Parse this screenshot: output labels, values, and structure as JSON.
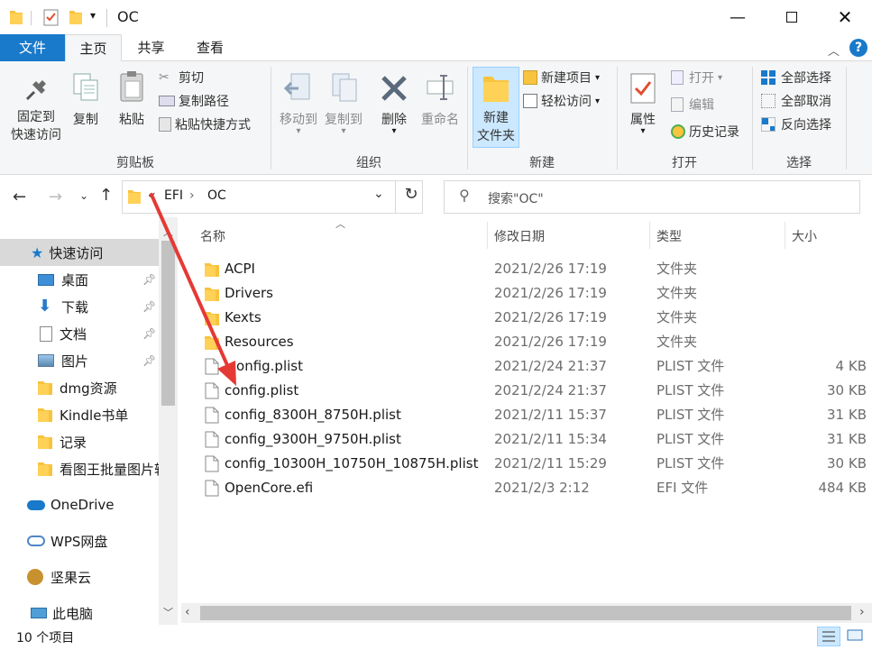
{
  "window": {
    "title": "OC"
  },
  "ribbon": {
    "tabs": [
      "文件",
      "主页",
      "共享",
      "查看"
    ],
    "clipboard": {
      "group": "剪贴板",
      "pin_label": "固定到\n快速访问",
      "copy": "复制",
      "paste": "粘贴",
      "cut": "剪切",
      "copy_path": "复制路径",
      "paste_shortcut": "粘贴快捷方式"
    },
    "organize": {
      "group": "组织",
      "move_to": "移动到",
      "copy_to": "复制到",
      "delete": "删除",
      "rename": "重命名"
    },
    "new": {
      "group": "新建",
      "new_folder": "新建\n文件夹",
      "new_item": "新建项目",
      "easy_access": "轻松访问"
    },
    "open": {
      "group": "打开",
      "properties": "属性",
      "open": "打开",
      "edit": "编辑",
      "history": "历史记录"
    },
    "select": {
      "group": "选择",
      "select_all": "全部选择",
      "select_none": "全部取消",
      "invert": "反向选择"
    }
  },
  "address": {
    "prefix": "«",
    "crumbs": [
      "EFI",
      "OC"
    ],
    "sep": "›"
  },
  "search": {
    "placeholder": "搜索\"OC\""
  },
  "nav": {
    "quick_access": "快速访问",
    "items": [
      {
        "label": "桌面",
        "icon": "desktop-icon",
        "pinned": true
      },
      {
        "label": "下载",
        "icon": "download-icon",
        "pinned": true
      },
      {
        "label": "文档",
        "icon": "document-icon",
        "pinned": true
      },
      {
        "label": "图片",
        "icon": "picture-icon",
        "pinned": true
      },
      {
        "label": "dmg资源",
        "icon": "folder-icon",
        "pinned": false
      },
      {
        "label": "Kindle书单",
        "icon": "folder-icon",
        "pinned": false
      },
      {
        "label": "记录",
        "icon": "folder-icon",
        "pinned": false
      },
      {
        "label": "看图王批量图片转",
        "icon": "folder-icon",
        "pinned": false
      }
    ],
    "onedrive": "OneDrive",
    "wps": "WPS网盘",
    "jianguo": "坚果云",
    "thispc": "此电脑"
  },
  "list": {
    "columns": {
      "name": "名称",
      "date": "修改日期",
      "type": "类型",
      "size": "大小"
    },
    "rows": [
      {
        "name": "ACPI",
        "date": "2021/2/26 17:19",
        "type": "文件夹",
        "size": "",
        "kind": "folder"
      },
      {
        "name": "Drivers",
        "date": "2021/2/26 17:19",
        "type": "文件夹",
        "size": "",
        "kind": "folder"
      },
      {
        "name": "Kexts",
        "date": "2021/2/26 17:19",
        "type": "文件夹",
        "size": "",
        "kind": "folder"
      },
      {
        "name": "Resources",
        "date": "2021/2/26 17:19",
        "type": "文件夹",
        "size": "",
        "kind": "folder"
      },
      {
        "name": ".config.plist",
        "date": "2021/2/24 21:37",
        "type": "PLIST 文件",
        "size": "4 KB",
        "kind": "file"
      },
      {
        "name": "config.plist",
        "date": "2021/2/24 21:37",
        "type": "PLIST 文件",
        "size": "30 KB",
        "kind": "file"
      },
      {
        "name": "config_8300H_8750H.plist",
        "date": "2021/2/11 15:37",
        "type": "PLIST 文件",
        "size": "31 KB",
        "kind": "file"
      },
      {
        "name": "config_9300H_9750H.plist",
        "date": "2021/2/11 15:34",
        "type": "PLIST 文件",
        "size": "31 KB",
        "kind": "file"
      },
      {
        "name": "config_10300H_10750H_10875H.plist",
        "date": "2021/2/11 15:29",
        "type": "PLIST 文件",
        "size": "30 KB",
        "kind": "file"
      },
      {
        "name": "OpenCore.efi",
        "date": "2021/2/3 2:12",
        "type": "EFI 文件",
        "size": "484 KB",
        "kind": "file"
      }
    ]
  },
  "status": {
    "count": "10 个项目"
  },
  "colors": {
    "accent": "#1979ca",
    "folder": "#f8c33e",
    "arrow": "#e53935",
    "selected": "#cce8ff"
  }
}
